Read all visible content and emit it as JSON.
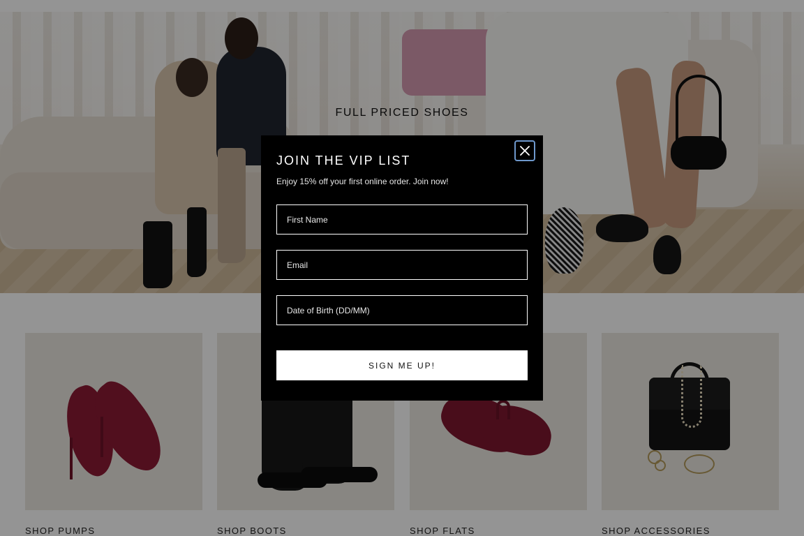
{
  "hero": {
    "title": "FULL PRICED SHOES"
  },
  "products": [
    {
      "label": "SHOP PUMPS",
      "image": "red-suede-pumps"
    },
    {
      "label": "SHOP BOOTS",
      "image": "black-combat-boots"
    },
    {
      "label": "SHOP FLATS",
      "image": "burgundy-velvet-mary-jane-flats"
    },
    {
      "label": "SHOP ACCESSORIES",
      "image": "black-handbag-with-jewelry"
    }
  ],
  "modal": {
    "title": "JOIN THE VIP LIST",
    "subtitle": "Enjoy 15% off your first online order. Join now!",
    "close_icon": "close-icon",
    "fields": {
      "first_name": {
        "placeholder": "First Name",
        "value": ""
      },
      "email": {
        "placeholder": "Email",
        "value": ""
      },
      "dob": {
        "placeholder": "Date of Birth (DD/MM)",
        "value": ""
      }
    },
    "submit_label": "SIGN ME UP!"
  },
  "colors": {
    "overlay": "#000000",
    "modal_background": "#000000",
    "close_focus_ring": "#6e98cc",
    "submit_background": "#ffffff"
  }
}
